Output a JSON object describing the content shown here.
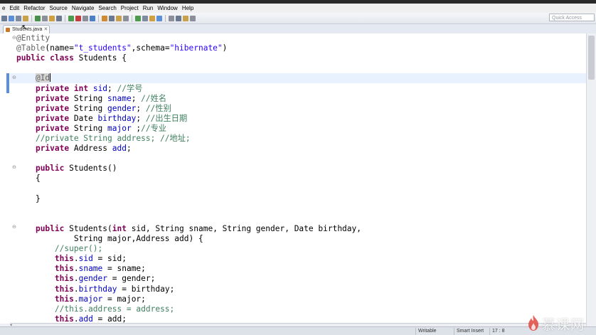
{
  "menu": {
    "items": [
      "e",
      "Edit",
      "Refactor",
      "Source",
      "Navigate",
      "Search",
      "Project",
      "Run",
      "Window",
      "Help"
    ]
  },
  "toolbar": {
    "quick_access_placeholder": "Quick Access"
  },
  "tabs": [
    {
      "label": "Students.java",
      "close": "✕"
    }
  ],
  "code_lines": [
    {
      "parts": [
        {
          "t": "@Entity",
          "c": "ann"
        }
      ]
    },
    {
      "parts": [
        {
          "t": "@Table",
          "c": "ann"
        },
        {
          "t": "(name=",
          "c": ""
        },
        {
          "t": "\"t_students\"",
          "c": "str"
        },
        {
          "t": ",schema=",
          "c": ""
        },
        {
          "t": "\"hibernate\"",
          "c": "str"
        },
        {
          "t": ")",
          "c": ""
        }
      ]
    },
    {
      "parts": [
        {
          "t": "public",
          "c": "kw"
        },
        {
          "t": " ",
          "c": ""
        },
        {
          "t": "class",
          "c": "kw"
        },
        {
          "t": " Students {",
          "c": ""
        }
      ]
    },
    {
      "parts": []
    },
    {
      "parts": [
        {
          "t": "    ",
          "c": ""
        },
        {
          "t": "@Id",
          "c": "ann ann-hl"
        },
        {
          "t": "",
          "c": "caret"
        }
      ]
    },
    {
      "parts": [
        {
          "t": "    ",
          "c": ""
        },
        {
          "t": "private",
          "c": "kw"
        },
        {
          "t": " ",
          "c": ""
        },
        {
          "t": "int",
          "c": "kw"
        },
        {
          "t": " ",
          "c": ""
        },
        {
          "t": "sid",
          "c": "fld"
        },
        {
          "t": "; ",
          "c": ""
        },
        {
          "t": "//学号",
          "c": "cmt"
        }
      ]
    },
    {
      "parts": [
        {
          "t": "    ",
          "c": ""
        },
        {
          "t": "private",
          "c": "kw"
        },
        {
          "t": " String ",
          "c": ""
        },
        {
          "t": "sname",
          "c": "fld"
        },
        {
          "t": "; ",
          "c": ""
        },
        {
          "t": "//姓名",
          "c": "cmt"
        }
      ]
    },
    {
      "parts": [
        {
          "t": "    ",
          "c": ""
        },
        {
          "t": "private",
          "c": "kw"
        },
        {
          "t": " String ",
          "c": ""
        },
        {
          "t": "gender",
          "c": "fld"
        },
        {
          "t": "; ",
          "c": ""
        },
        {
          "t": "//性别",
          "c": "cmt"
        }
      ]
    },
    {
      "parts": [
        {
          "t": "    ",
          "c": ""
        },
        {
          "t": "private",
          "c": "kw"
        },
        {
          "t": " Date ",
          "c": ""
        },
        {
          "t": "birthday",
          "c": "fld"
        },
        {
          "t": "; ",
          "c": ""
        },
        {
          "t": "//出生日期",
          "c": "cmt"
        }
      ]
    },
    {
      "parts": [
        {
          "t": "    ",
          "c": ""
        },
        {
          "t": "private",
          "c": "kw"
        },
        {
          "t": " String ",
          "c": ""
        },
        {
          "t": "major",
          "c": "fld"
        },
        {
          "t": " ;",
          "c": ""
        },
        {
          "t": "//专业",
          "c": "cmt"
        }
      ]
    },
    {
      "parts": [
        {
          "t": "    ",
          "c": ""
        },
        {
          "t": "//private String address; //地址;",
          "c": "cmt"
        }
      ]
    },
    {
      "parts": [
        {
          "t": "    ",
          "c": ""
        },
        {
          "t": "private",
          "c": "kw"
        },
        {
          "t": " Address ",
          "c": ""
        },
        {
          "t": "add",
          "c": "fld"
        },
        {
          "t": ";",
          "c": ""
        }
      ]
    },
    {
      "parts": []
    },
    {
      "parts": [
        {
          "t": "    ",
          "c": ""
        },
        {
          "t": "public",
          "c": "kw"
        },
        {
          "t": " Students()",
          "c": ""
        }
      ]
    },
    {
      "parts": [
        {
          "t": "    {",
          "c": ""
        }
      ]
    },
    {
      "parts": []
    },
    {
      "parts": [
        {
          "t": "    }",
          "c": ""
        }
      ]
    },
    {
      "parts": []
    },
    {
      "parts": []
    },
    {
      "parts": [
        {
          "t": "    ",
          "c": ""
        },
        {
          "t": "public",
          "c": "kw"
        },
        {
          "t": " Students(",
          "c": ""
        },
        {
          "t": "int",
          "c": "kw"
        },
        {
          "t": " sid, String sname, String gender, Date birthday,",
          "c": ""
        }
      ]
    },
    {
      "parts": [
        {
          "t": "            String major,Address add) {",
          "c": ""
        }
      ]
    },
    {
      "parts": [
        {
          "t": "        ",
          "c": ""
        },
        {
          "t": "//super();",
          "c": "cmt"
        }
      ]
    },
    {
      "parts": [
        {
          "t": "        ",
          "c": ""
        },
        {
          "t": "this",
          "c": "kw"
        },
        {
          "t": ".",
          "c": ""
        },
        {
          "t": "sid",
          "c": "fld"
        },
        {
          "t": " = sid;",
          "c": ""
        }
      ]
    },
    {
      "parts": [
        {
          "t": "        ",
          "c": ""
        },
        {
          "t": "this",
          "c": "kw"
        },
        {
          "t": ".",
          "c": ""
        },
        {
          "t": "sname",
          "c": "fld"
        },
        {
          "t": " = sname;",
          "c": ""
        }
      ]
    },
    {
      "parts": [
        {
          "t": "        ",
          "c": ""
        },
        {
          "t": "this",
          "c": "kw"
        },
        {
          "t": ".",
          "c": ""
        },
        {
          "t": "gender",
          "c": "fld"
        },
        {
          "t": " = gender;",
          "c": ""
        }
      ]
    },
    {
      "parts": [
        {
          "t": "        ",
          "c": ""
        },
        {
          "t": "this",
          "c": "kw"
        },
        {
          "t": ".",
          "c": ""
        },
        {
          "t": "birthday",
          "c": "fld"
        },
        {
          "t": " = birthday;",
          "c": ""
        }
      ]
    },
    {
      "parts": [
        {
          "t": "        ",
          "c": ""
        },
        {
          "t": "this",
          "c": "kw"
        },
        {
          "t": ".",
          "c": ""
        },
        {
          "t": "major",
          "c": "fld"
        },
        {
          "t": " = major;",
          "c": ""
        }
      ]
    },
    {
      "parts": [
        {
          "t": "        ",
          "c": ""
        },
        {
          "t": "//this.address = address;",
          "c": "cmt"
        }
      ]
    },
    {
      "parts": [
        {
          "t": "        ",
          "c": ""
        },
        {
          "t": "this",
          "c": "kw"
        },
        {
          "t": ".",
          "c": ""
        },
        {
          "t": "add",
          "c": "fld"
        },
        {
          "t": " = add;",
          "c": ""
        }
      ]
    }
  ],
  "status": {
    "writable": "Writable",
    "insert_mode": "Smart Insert",
    "position": "17 : 8"
  },
  "watermark": {
    "text": "慕课网"
  },
  "colors": {
    "keyword": "#7f0055",
    "string": "#2a00ff",
    "field": "#0000c0",
    "comment": "#3f7f5f",
    "annotation": "#646464",
    "current_line": "#e8f2fe"
  }
}
